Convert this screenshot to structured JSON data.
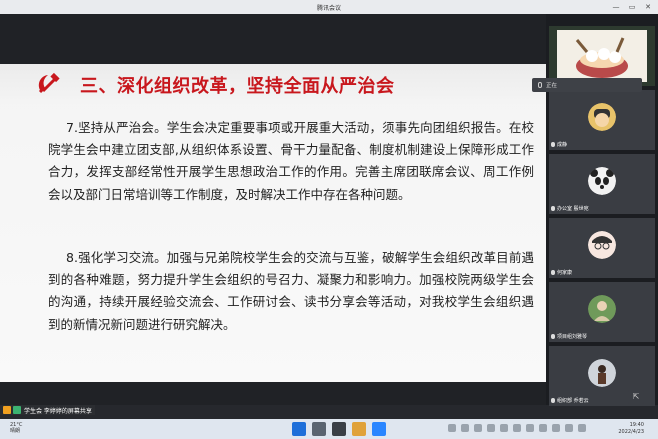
{
  "window": {
    "title": "腾讯会议",
    "controls": [
      "—",
      "▭",
      "✕"
    ]
  },
  "slide": {
    "heading": "三、深化组织改革，坚持全面从严治会",
    "paragraph1": "7.坚持从严治会。学生会决定重要事项或开展重大活动，须事先向团组织报告。在校院学生会中建立团支部,从组织体系设置、骨干力量配备、制度机制建设上保障形成工作合力，发挥支部经常性开展学生思想政治工作的作用。完善主席团联席会议、周工作例会以及部门日常培训等工作制度，及时解决工作中存在各种问题。",
    "paragraph2": "8.强化学习交流。加强与兄弟院校学生会的交流与互鉴，破解学生会组织改革目前遇到的各种难题，努力提升学生会组织的号召力、凝聚力和影响力。加强校院两级学生会的沟通，持续开展经验交流会、工作研讨会、读书分享会等活动，对我校学生会组织遇到的新情况新问题进行研究解决。",
    "emblem_icon": "hammer-sickle-icon",
    "heading_color": "#c8171d"
  },
  "share_status": {
    "text": "学生会 李婷婷的屏幕共享"
  },
  "speaking_tooltip": {
    "text": "正在"
  },
  "participants": [
    {
      "name": "",
      "avatar": "food-bowl-avatar"
    },
    {
      "name": "成静",
      "avatar": "cartoon-avatar"
    },
    {
      "name": "办公室 殷世宛",
      "avatar": "panda-avatar"
    },
    {
      "name": "何家康",
      "avatar": "person-glasses-avatar"
    },
    {
      "name": "项目组刘雅琴",
      "avatar": "photo-avatar"
    },
    {
      "name": "组织部 乔若云",
      "avatar": "photo-avatar"
    }
  ],
  "taskbar": {
    "weather_temp": "21°C",
    "weather_desc": "晴朗",
    "time": "19:40",
    "date": "2022/4/23"
  }
}
